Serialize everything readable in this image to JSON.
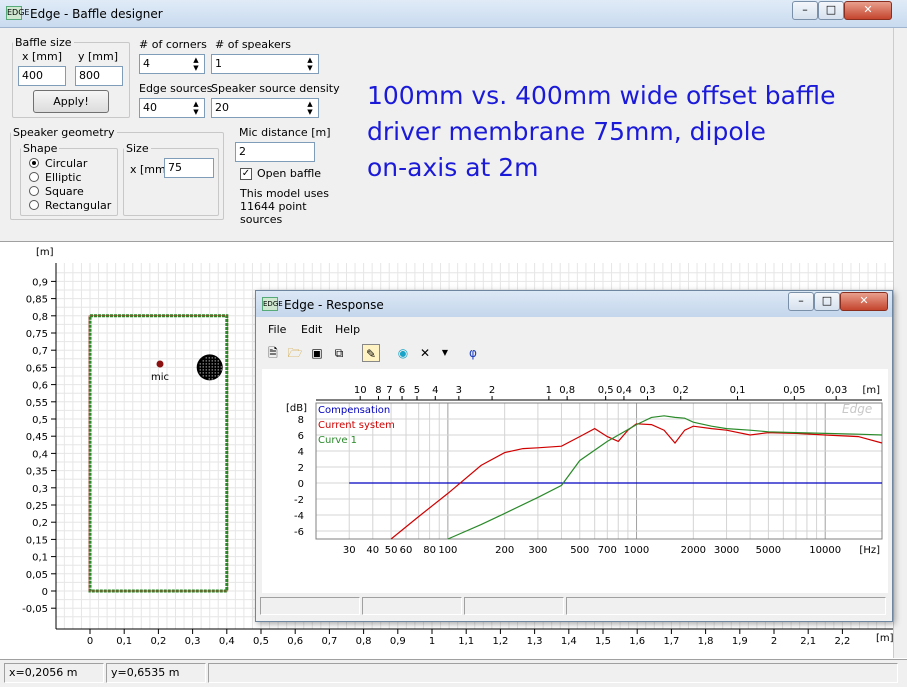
{
  "window": {
    "title": "Edge - Baffle designer",
    "icon_text": "EDGE"
  },
  "controls": {
    "baffle_size": {
      "legend": "Baffle size",
      "x_label": "x [mm]",
      "y_label": "y [mm]",
      "x_value": "400",
      "y_value": "800",
      "apply_label": "Apply!"
    },
    "corners": {
      "label": "# of corners",
      "value": "4"
    },
    "speakers": {
      "label": "# of speakers",
      "value": "1"
    },
    "edge_sources": {
      "label": "Edge sources",
      "value": "40"
    },
    "source_density": {
      "label": "Speaker source density",
      "value": "20"
    },
    "speaker_geometry": {
      "legend": "Speaker geometry",
      "shape_legend": "Shape",
      "shapes": [
        "Circular",
        "Elliptic",
        "Square",
        "Rectangular"
      ],
      "selected_shape": "Circular",
      "size_legend": "Size",
      "size_label": "x [mm]",
      "size_value": "75"
    },
    "mic_distance": {
      "label": "Mic distance [m]",
      "value": "2"
    },
    "open_baffle": {
      "label": "Open baffle",
      "checked": true
    },
    "model_info": [
      "This model uses",
      "11644 point",
      "sources"
    ]
  },
  "annotation": {
    "line1": "100mm vs. 400mm wide offset baffle",
    "line2": "driver membrane 75mm, dipole",
    "line3": "on-axis at 2m",
    "color": "#1a1ad8"
  },
  "baffle_plot": {
    "y_unit": "[m]",
    "x_unit": "[m]",
    "y_ticks": [
      "0,9",
      "0,85",
      "0,8",
      "0,75",
      "0,7",
      "0,65",
      "0,6",
      "0,55",
      "0,5",
      "0,45",
      "0,4",
      "0,35",
      "0,3",
      "0,25",
      "0,2",
      "0,15",
      "0,1",
      "0,05",
      "0",
      "-0,05"
    ],
    "x_ticks": [
      "0",
      "0,1",
      "0,2",
      "0,3",
      "0,4",
      "0,5",
      "0,6",
      "0,7",
      "0,8",
      "0,9",
      "1",
      "1,1",
      "1,2",
      "1,3",
      "1,4",
      "1,5",
      "1,6",
      "1,7",
      "1,8",
      "1,9",
      "2",
      "2,1",
      "2,2"
    ],
    "mic_label": "mic",
    "baffle_color": "#2a8a2a"
  },
  "status": {
    "x_readout": "x=0,2056 m",
    "y_readout": "y=0,6535 m"
  },
  "response_window": {
    "title": "Edge - Response",
    "menu": [
      "File",
      "Edit",
      "Help"
    ],
    "toolbar_icons": [
      "new-file-icon",
      "open-folder-icon",
      "save-icon",
      "copy-icon",
      "pencil-icon",
      "globe-icon",
      "delete-x-icon",
      "dropdown-arrow-icon",
      "phi-icon"
    ],
    "phi_glyph": "φ",
    "watermark": "Edge"
  },
  "chart_data": {
    "type": "line",
    "title": "",
    "xlabel": "[Hz]",
    "ylabel": "[dB]",
    "x_scale": "log",
    "xlim": [
      20,
      20000
    ],
    "ylim": [
      -7,
      10
    ],
    "x_tick_labels": [
      "30",
      "40",
      "50",
      "60",
      "80",
      "100",
      "200",
      "300",
      "500",
      "700",
      "1000",
      "2000",
      "3000",
      "5000",
      "10000"
    ],
    "y_tick_labels": [
      "8",
      "6",
      "4",
      "2",
      "0",
      "-2",
      "-4",
      "-6"
    ],
    "top_axis_label": "[m]",
    "top_tick_labels": [
      "10",
      "8",
      "7",
      "6",
      "5",
      "4",
      "3",
      "2",
      "1",
      "0,8",
      "0,5",
      "0,4",
      "0,3",
      "0,2",
      "0,1",
      "0,05",
      "0,03"
    ],
    "grid": true,
    "legend_position": "top-left",
    "series": [
      {
        "name": "Compensation",
        "color": "#0000c0",
        "x": [
          30,
          20000
        ],
        "y": [
          0,
          0
        ]
      },
      {
        "name": "Current system",
        "color": "#d00000",
        "x": [
          50,
          70,
          100,
          150,
          200,
          250,
          300,
          400,
          500,
          600,
          700,
          800,
          900,
          1000,
          1200,
          1400,
          1600,
          1800,
          2000,
          2500,
          3000,
          4000,
          5000,
          7000,
          10000,
          15000,
          20000
        ],
        "y": [
          -7,
          -4.2,
          -1.3,
          2.2,
          3.8,
          4.3,
          4.4,
          4.6,
          5.8,
          6.8,
          5.8,
          5.2,
          6.6,
          7.4,
          7.3,
          6.6,
          5.0,
          6.6,
          7.1,
          6.8,
          6.6,
          6.0,
          6.3,
          6.2,
          6.0,
          5.8,
          5.0
        ]
      },
      {
        "name": "Curve 1",
        "color": "#2a8a2a",
        "x": [
          100,
          150,
          200,
          300,
          400,
          500,
          700,
          1000,
          1200,
          1400,
          1600,
          1800,
          2000,
          2500,
          3000,
          4000,
          5000,
          7000,
          10000,
          15000,
          20000
        ],
        "y": [
          -7,
          -5.2,
          -3.8,
          -1.8,
          -0.3,
          2.8,
          5.2,
          7.3,
          8.2,
          8.4,
          8.2,
          8.1,
          7.6,
          7.1,
          6.8,
          6.6,
          6.4,
          6.3,
          6.2,
          6.1,
          6.0
        ]
      }
    ]
  }
}
